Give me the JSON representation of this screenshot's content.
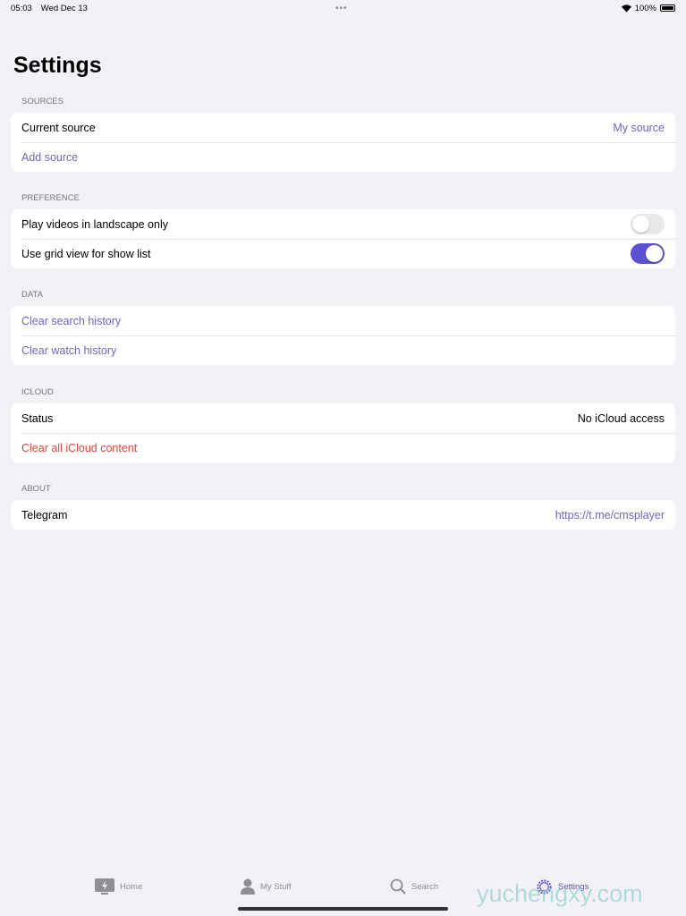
{
  "status_bar": {
    "time": "05:03",
    "date": "Wed Dec 13",
    "battery": "100%",
    "battery_level": 100
  },
  "title": "Settings",
  "sections": {
    "sources": {
      "header": "SOURCES",
      "current_label": "Current source",
      "current_value": "My source",
      "add": "Add source"
    },
    "preference": {
      "header": "PREFERENCE",
      "landscape": "Play videos in landscape only",
      "landscape_on": false,
      "grid": "Use grid view for show list",
      "grid_on": true
    },
    "data": {
      "header": "DATA",
      "clear_search": "Clear search history",
      "clear_watch": "Clear watch history"
    },
    "icloud": {
      "header": "ICLOUD",
      "status_label": "Status",
      "status_value": "No iCloud access",
      "clear": "Clear all iCloud content"
    },
    "about": {
      "header": "ABOUT",
      "telegram_label": "Telegram",
      "telegram_value": "https://t.me/cmsplayer"
    }
  },
  "tabs": [
    {
      "label": "Home",
      "icon": "tv-icon"
    },
    {
      "label": "My Stuff",
      "icon": "person-icon"
    },
    {
      "label": "Search",
      "icon": "search-icon"
    },
    {
      "label": "Settings",
      "icon": "gear-icon",
      "active": true
    }
  ],
  "watermark": "yuchengxy.com",
  "colors": {
    "accent": "#7064c6",
    "toggle_on": "#5b50cf",
    "destructive": "#e0443e",
    "background": "#f2f1f6"
  }
}
